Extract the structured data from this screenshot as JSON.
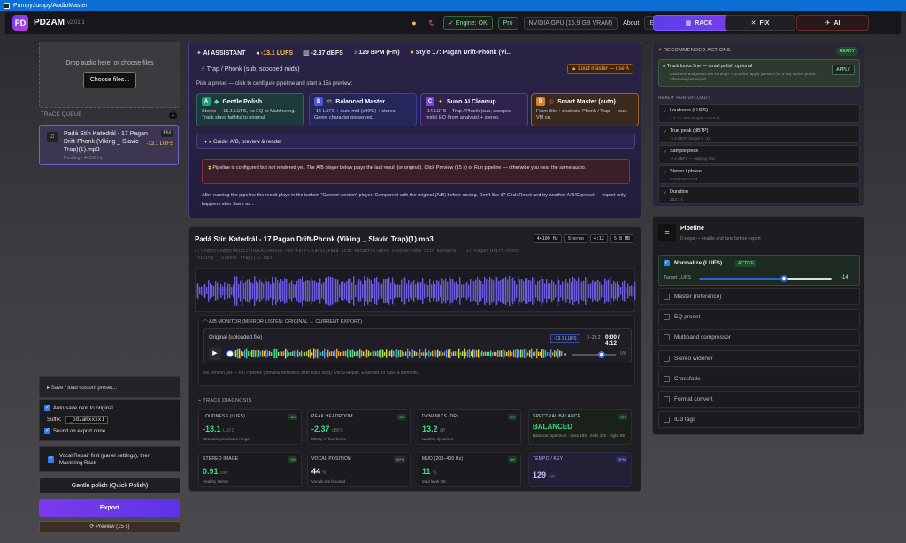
{
  "window": {
    "title": "PumpyJumpy/AudioMaster"
  },
  "header": {
    "app_name": "PD2AM",
    "version": "v2.01.1",
    "engine": "✓ Engine: OK",
    "tier": "Pro",
    "gpu": "NVIDIA GPU (15.9 GB VRAM)",
    "about": "About",
    "lang": "EN",
    "modes": {
      "rack": "RACK",
      "fix": "FIX",
      "ai": "AI"
    }
  },
  "left": {
    "drop_text": "Drop audio here, or choose files",
    "choose_label": "Choose files...",
    "queue_label": "TRACK QUEUE",
    "queue_count": "1",
    "queue_item": {
      "name": "Padá Stín Katedrál - 17 Pagan Drift-Phonk (Viking _ Slavic Trap)(1).mp3",
      "sub": "Pending · 44100 Hz",
      "tag": "FM",
      "lufs": "-13.1 LUFS"
    },
    "preset_toggle": "Save / load custom preset...",
    "autosave": "Auto-save next to original",
    "suffix_label": "Suffix:",
    "suffix_value": "_pd2amxxxx1",
    "sound_on_export": "Sound on export done",
    "vocal_repair": "Vocal Repair first (panel settings), then Mastering Rack",
    "gentle_button": "Gentle polish (Quick Polish)",
    "export_button": "Export",
    "preview_button": "⟳ Preview (15 s)"
  },
  "ai": {
    "title": "AI ASSISTANT",
    "lufs": "-13.1 LUFS",
    "dbfs": "-2.37 dBFS",
    "bpm": "129 BPM (Fm)",
    "style": "Style 17: Pagan Drift-Phonk (Vi...",
    "genre": "Trap / Phonk (sub, scooped mids)",
    "loud_badge": "Loud master — use A",
    "pick_text": "Pick a preset — click to configure pipeline and start a 15s preview:",
    "presets": [
      {
        "badge": "A",
        "name": "Gentle Polish",
        "desc": "Stereo + -15.1 LUFS, no EQ or Matchering. Track stays faithful to original.",
        "color": "#1f9d7a"
      },
      {
        "badge": "B",
        "name": "Balanced Master",
        "desc": "-14 LUFS + Auto mid (x40%) + stereo. Genre character preserved.",
        "color": "#4c55d8"
      },
      {
        "badge": "C",
        "name": "Suno AI Cleanup",
        "desc": "-14 LUFS + Trap / Phonk (sub, scooped mids) EQ (from analysis) + stereo.",
        "color": "#7a44d6"
      },
      {
        "badge": "D",
        "name": "Smart Master (auto)",
        "desc": "From title + analysis: Phonk / Trap — loud. VM on.",
        "color": "#d9822b"
      }
    ],
    "guide": "Guide: A/B, preview & render",
    "warning": "Pipeline is configured but not rendered yet. The A/B player below plays the last result (or original). Click Preview (15 s) or Run pipeline — otherwise you hear the same audio.",
    "after": "After running the pipeline the result plays in the bottom \"Current version\" player. Compare it with the original (A/B) before saving. Don't like it? Click Reset and try another A/B/C preset — export only happens after Save as..."
  },
  "track": {
    "title": "Padá Stín Katedrál - 17 Pagan Drift-Phonk (Viking _ Slavic Trap)(1).mp3",
    "path": "C:\\Pumpy\\Jumpy\\Music\\TRACKS\\Music-for-test\\Slavic\\Padá Stín Katedrál\\Nová složka\\Padá Stín Katedrál - 17 Pagan Drift-Phonk (Viking _ Slavic Trap)(1).mp3",
    "chips": [
      "44100 Hz",
      "Stereo",
      "4:12",
      "5.8 MB"
    ],
    "ab_title": "A/B MONITOR (MIRROR LISTEN: ORIGINAL → CURRENT EXPORT)",
    "orig_label": "Original (uploaded file)",
    "ab_lufs": "-13.1 LUFS",
    "ab_db": "0 -28.2",
    "time": "0:00 / 4:12",
    "volume": "0%",
    "no_version": "No version yet — run Pipeline (preview refreshes after each step), Vocal Repair, Extender, or save a stem mix.",
    "diag_label": "TRACK DIAGNOSIS",
    "diag": [
      {
        "label": "LOUDNESS (LUFS)",
        "status": "OK",
        "value": "-13.1",
        "unit": "LUFS",
        "sub": "Streaming-loudness range"
      },
      {
        "label": "PEAK HEADROOM",
        "status": "OK",
        "value": "-2.37",
        "unit": "dBFS",
        "sub": "Plenty of headroom"
      },
      {
        "label": "DYNAMICS (DR)",
        "status": "OK",
        "value": "13.2",
        "unit": "dB",
        "sub": "Healthy dynamics"
      },
      {
        "label": "SPECTRAL BALANCE",
        "status": "OK",
        "value": "BALANCED",
        "unit": "",
        "sub": "Balanced spectrum · bass 183 · mids 335 · highs 88"
      },
      {
        "label": "STEREO IMAGE",
        "status": "OK",
        "value": "0.91",
        "unit": "corr",
        "sub": "Healthy stereo"
      },
      {
        "label": "VOCAL POSITION",
        "status": "INFO",
        "value": "44",
        "unit": "%",
        "sub": "Vocals are focused"
      },
      {
        "label": "MUD (200–400 Hz)",
        "status": "OK",
        "value": "11",
        "unit": "%",
        "sub": "Mud level OK"
      },
      {
        "label": "TEMPO / KEY",
        "status": "BPM",
        "value": "129",
        "unit": "Fm",
        "sub": ""
      }
    ]
  },
  "recs": {
    "title": "RECOMMENDED ACTIONS",
    "ready": "READY",
    "tip_title": "Track looks fine — small polish optional",
    "tip_desc": "Loudness and peaks are in range. If you like, apply preset A for a tiny stereo polish, otherwise just export.",
    "apply": "APPLY",
    "upload_label": "READY FOR UPLOAD?",
    "checks": [
      {
        "title": "Loudness (LUFS)",
        "sub": "-13.1 LUFS (target -14 ±0.8)"
      },
      {
        "title": "True peak (dBTP)",
        "sub": "-2.4 dBTP (target ≤ -1)"
      },
      {
        "title": "Sample peak",
        "sub": "-2.4 dBFS — clipping risk"
      },
      {
        "title": "Stereo / phase",
        "sub": "Correlation 0.91"
      },
      {
        "title": "Duration",
        "sub": "252.3 s"
      }
    ]
  },
  "pipeline": {
    "title": "Pipeline",
    "subtitle": "0 steps — enable and tune before export",
    "normalize": "Normalize (LUFS)",
    "active": "ACTIVE",
    "target_label": "Target LUFS",
    "target_value": "-14",
    "target_fraction": 0.62,
    "steps": [
      "Master (reference)",
      "EQ preset",
      "Multiband compressor",
      "Stereo widener",
      "Crossfade",
      "Format convert",
      "ID3 tags"
    ]
  }
}
